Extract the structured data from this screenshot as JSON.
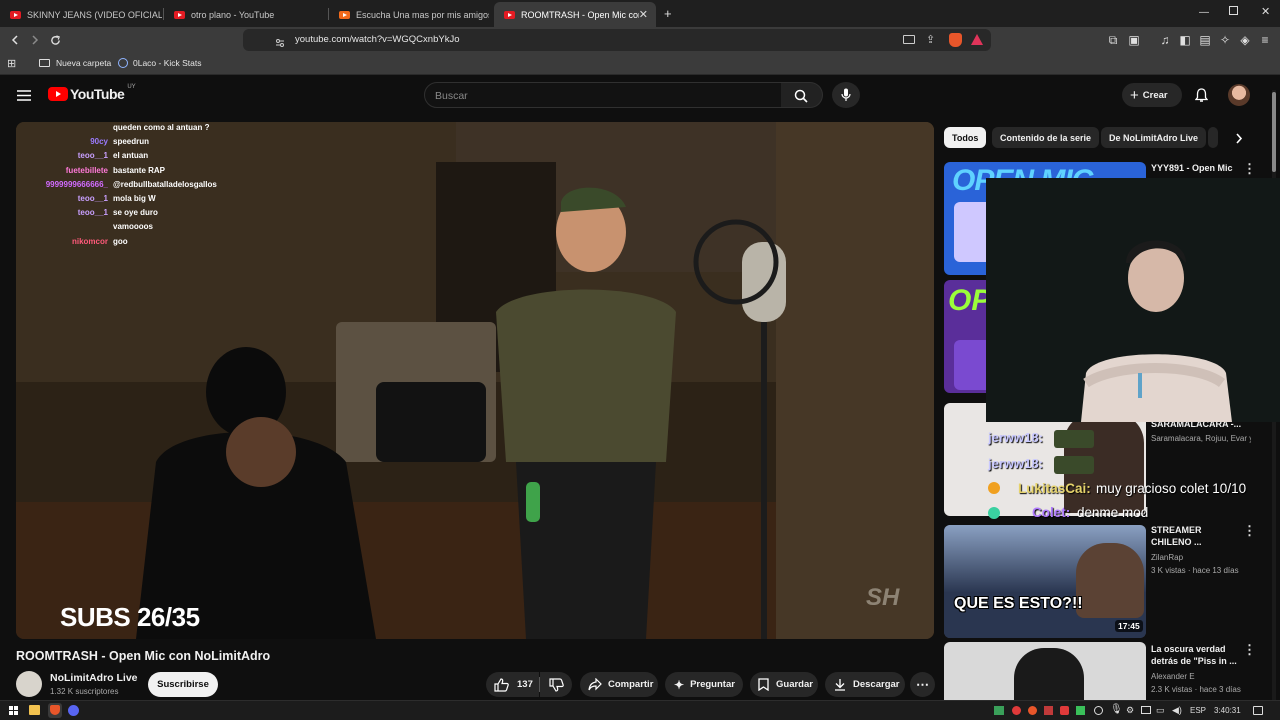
{
  "browser": {
    "tabs": [
      {
        "label": "SKINNY JEANS (VIDEO OFICIAL) - Yo",
        "active": false
      },
      {
        "label": "otro plano - YouTube",
        "active": false
      },
      {
        "label": "Escucha Una mas por mis amigos. Pr",
        "active": false
      },
      {
        "label": "ROOMTRASH - Open Mic con N",
        "active": true
      }
    ],
    "new_tab": "+",
    "url": "youtube.com/watch?v=WGQCxnbYkJo",
    "bookmarks": [
      {
        "label": "Nueva carpeta",
        "icon": "folder-icon"
      },
      {
        "label": "0Laco - Kick Stats",
        "icon": "kick-icon"
      }
    ]
  },
  "youtube": {
    "logo_text": "YouTube",
    "region": "UY",
    "search_placeholder": "Buscar",
    "create_label": "Crear"
  },
  "video": {
    "overlay_text": "SUBS 26/35",
    "watermark": "SH",
    "chat": [
      {
        "name": "",
        "message": "queden como al antuan ?",
        "color": "#ffffff"
      },
      {
        "name": "90cy",
        "message": "speedrun",
        "color": "#9b7bff"
      },
      {
        "name": "teoo__1",
        "message": "el antuan",
        "color": "#c9a0ff"
      },
      {
        "name": "fuetebillete",
        "message": "bastante RAP",
        "color": "#ff7ad9"
      },
      {
        "name": "9999999666666_",
        "message": "@redbullbatalladelosgallos",
        "color": "#d26bff"
      },
      {
        "name": "teoo__1",
        "message": "mola big W",
        "color": "#c9a0ff"
      },
      {
        "name": "teoo__1",
        "message": "se oye duro",
        "color": "#c9a0ff"
      },
      {
        "name": "",
        "message": "vamoooos",
        "color": "#6b6bff"
      },
      {
        "name": "nikomcor",
        "message": "goo",
        "color": "#ff5a7a"
      }
    ]
  },
  "video_info": {
    "title": "ROOMTRASH - Open Mic con NoLimitAdro",
    "channel": "NoLimitAdro Live",
    "subscribers": "1.32 K suscriptores",
    "subscribe_label": "Suscribirse",
    "likes": "137",
    "share_label": "Compartir",
    "ask_label": "Preguntar",
    "save_label": "Guardar",
    "download_label": "Descargar"
  },
  "chips": [
    "Todos",
    "Contenido de la serie",
    "De NoLimitAdro Live"
  ],
  "recommendations": [
    {
      "title": "YYY891 - Open Mic",
      "title2": "",
      "meta": "",
      "meta2": "",
      "duration": "",
      "thumb_text": "OPEN MIC"
    },
    {
      "title": "",
      "title2": "",
      "meta": "",
      "meta2": "",
      "duration": "",
      "thumb_text": "OP"
    },
    {
      "title": "SARAMALACARA -...",
      "title2": "",
      "meta": "Saramalacara, Rojuu, Evar y...",
      "meta2": "",
      "duration": "",
      "thumb_text": ""
    },
    {
      "title": "STREAMER",
      "title2": "CHILENO ...",
      "meta": "ZilanRap",
      "meta2": "3 K vistas · hace 13 días",
      "duration": "17:45",
      "thumb_text": "QUE ES ESTO?!!"
    },
    {
      "title": "La oscura verdad",
      "title2": "detrás de \"Piss in ...",
      "meta": "Alexander E",
      "meta2": "2.3 K vistas · hace 3 días",
      "duration": "",
      "thumb_text": ""
    }
  ],
  "stream_overlay_chat": [
    {
      "name": "jerww18:",
      "message": "",
      "color": "#c9c9ff"
    },
    {
      "name": "jerww18:",
      "message": "",
      "color": "#c9c9ff"
    },
    {
      "name": "LukitasCai:",
      "message": "muy gracioso colet 10/10",
      "color": "#e6d36b"
    },
    {
      "name": "Colet:",
      "message": "denme mod",
      "color": "#b07bff"
    }
  ],
  "taskbar": {
    "language": "ESP",
    "time": "3:40:31"
  }
}
